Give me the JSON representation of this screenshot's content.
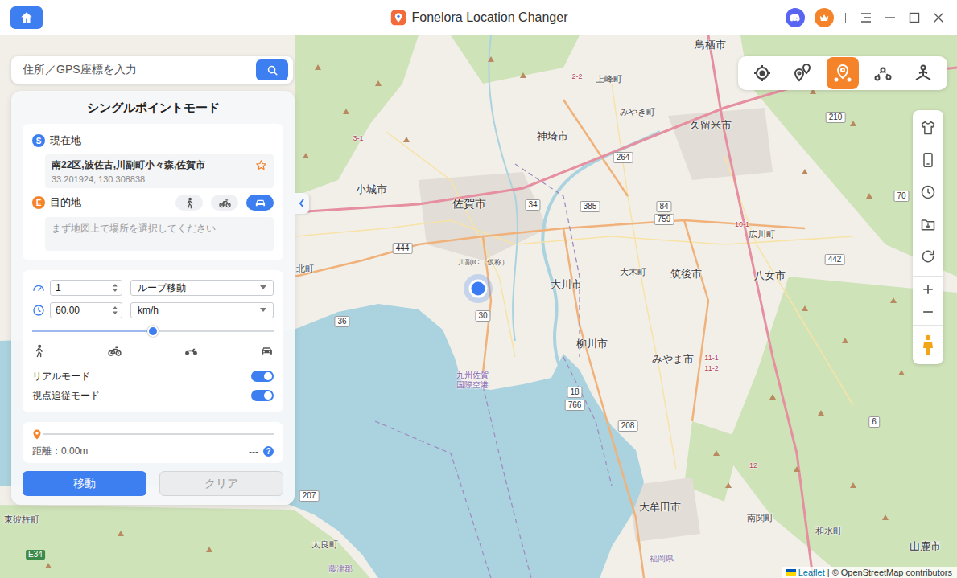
{
  "window": {
    "title": "Fonelora Location Changer"
  },
  "search": {
    "placeholder": "住所／GPS座標を入力"
  },
  "map_tools": [
    {
      "kind": "teleport",
      "selected": false
    },
    {
      "kind": "two-spot",
      "selected": false
    },
    {
      "kind": "multi-spot",
      "selected": true
    },
    {
      "kind": "jump",
      "selected": false
    },
    {
      "kind": "joystick",
      "selected": false
    }
  ],
  "panel": {
    "title": "シングルポイントモード",
    "start": {
      "badge": "S",
      "label": "現在地",
      "address": "南22区,波佐古,川副町小々森,佐賀市",
      "coords": "33.201924, 130.308838",
      "favorite": false
    },
    "end": {
      "badge": "E",
      "label": "目的地",
      "placeholder": "まず地図上で場所を選択してください"
    },
    "transport_modes": [
      {
        "kind": "walk",
        "selected": false
      },
      {
        "kind": "bike",
        "selected": false
      },
      {
        "kind": "car",
        "selected": true
      }
    ],
    "repeat": {
      "value": "1"
    },
    "route_mode": {
      "value": "ループ移動"
    },
    "speed": {
      "value": "60.00"
    },
    "speed_unit": {
      "value": "km/h"
    },
    "speed_slider": {
      "level": 0.5
    },
    "toggles": [
      {
        "label": "リアルモード",
        "on": true
      },
      {
        "label": "視点追従モード",
        "on": true
      }
    ],
    "progress": {
      "level": 0,
      "distance": "距離：0.00m",
      "eta": "---",
      "help": "?"
    },
    "buttons": [
      {
        "label": "移動",
        "kind": "primary",
        "disabled": false
      },
      {
        "label": "クリア",
        "kind": "secondary",
        "disabled": true
      }
    ]
  },
  "map": {
    "labels": [
      {
        "text": "鳥栖市",
        "kind": "city"
      },
      {
        "text": "上峰町",
        "kind": "town"
      },
      {
        "text": "みやき町",
        "kind": "town"
      },
      {
        "text": "神埼市",
        "kind": "city"
      },
      {
        "text": "久留米市",
        "kind": "city"
      },
      {
        "text": "小城市",
        "kind": "city"
      },
      {
        "text": "佐賀市",
        "kind": "city-big"
      },
      {
        "text": "大川市",
        "kind": "city"
      },
      {
        "text": "大木町",
        "kind": "town"
      },
      {
        "text": "筑後市",
        "kind": "city"
      },
      {
        "text": "八女市",
        "kind": "city"
      },
      {
        "text": "広川町",
        "kind": "town"
      },
      {
        "text": "柳川市",
        "kind": "city"
      },
      {
        "text": "みやま市",
        "kind": "city"
      },
      {
        "text": "大牟田市",
        "kind": "city"
      },
      {
        "text": "南関町",
        "kind": "town"
      },
      {
        "text": "和水町",
        "kind": "town"
      },
      {
        "text": "山鹿市",
        "kind": "city"
      },
      {
        "text": "北町",
        "kind": "town"
      },
      {
        "text": "東彼杵町",
        "kind": "town"
      },
      {
        "text": "太良町",
        "kind": "town"
      },
      {
        "text": "藤津郡",
        "kind": "pref"
      },
      {
        "text": "福岡県",
        "kind": "pref"
      },
      {
        "text": "九州佐賀国際空港",
        "kind": "airport"
      },
      {
        "text": "川副IC（仮称）",
        "kind": "ic"
      },
      {
        "text": "444",
        "kind": "shield"
      },
      {
        "text": "264",
        "kind": "shield"
      },
      {
        "text": "385",
        "kind": "shield"
      },
      {
        "text": "34",
        "kind": "shield"
      },
      {
        "text": "84",
        "kind": "shield"
      },
      {
        "text": "759",
        "kind": "shield"
      },
      {
        "text": "210",
        "kind": "shield"
      },
      {
        "text": "70",
        "kind": "shield"
      },
      {
        "text": "442",
        "kind": "shield"
      },
      {
        "text": "36",
        "kind": "shield"
      },
      {
        "text": "30",
        "kind": "shield"
      },
      {
        "text": "18",
        "kind": "shield"
      },
      {
        "text": "766",
        "kind": "shield"
      },
      {
        "text": "208",
        "kind": "shield"
      },
      {
        "text": "207",
        "kind": "shield"
      },
      {
        "text": "6",
        "kind": "shield"
      },
      {
        "text": "E34",
        "kind": "expressway"
      },
      {
        "text": "3-1",
        "kind": "route"
      },
      {
        "text": "2-2",
        "kind": "route"
      },
      {
        "text": "10-1",
        "kind": "route"
      },
      {
        "text": "11-1",
        "kind": "route"
      },
      {
        "text": "11-2",
        "kind": "route"
      },
      {
        "text": "12",
        "kind": "route"
      }
    ],
    "attribution": {
      "link": "Leaflet",
      "text": "| © OpenStreetMap contributors"
    }
  }
}
